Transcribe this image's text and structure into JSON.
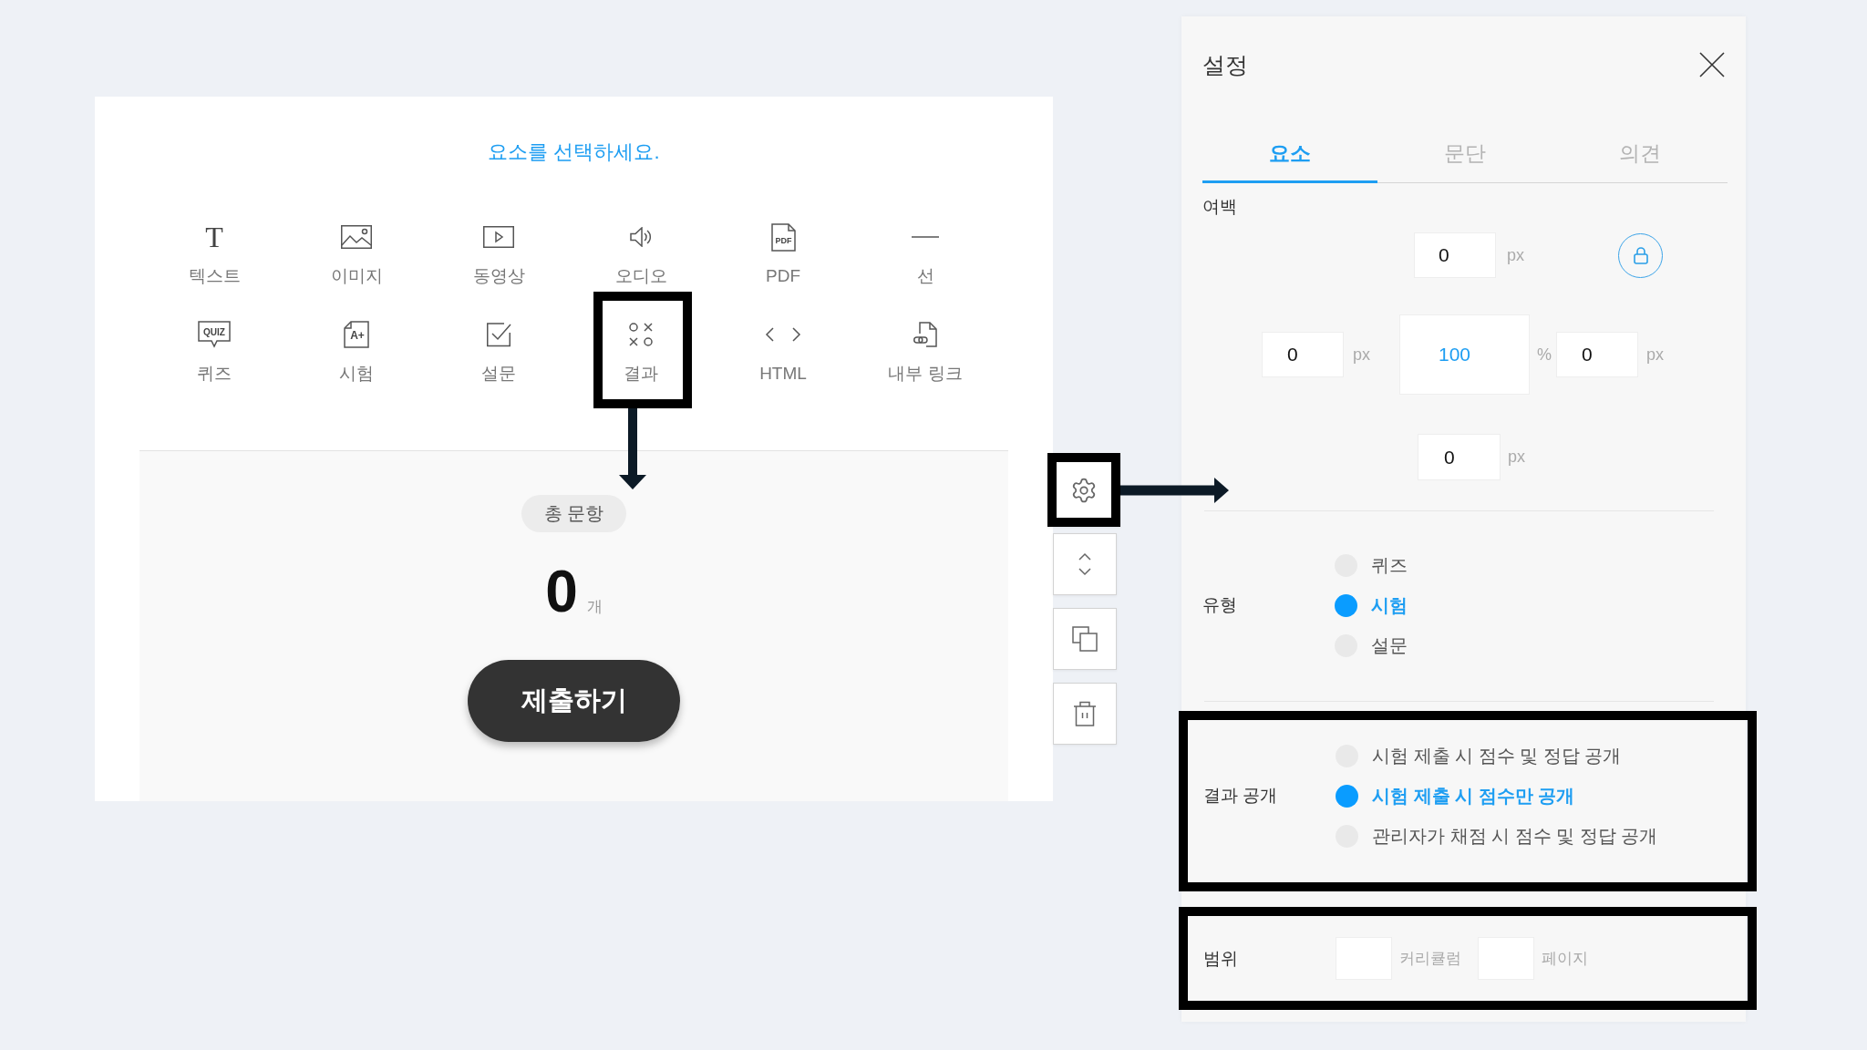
{
  "editor": {
    "prompt": "요소를 선택하세요.",
    "elements": [
      {
        "label": "텍스트",
        "kind": "letter",
        "icon_text": "T",
        "highlighted": false
      },
      {
        "label": "이미지",
        "kind": "image",
        "highlighted": false
      },
      {
        "label": "동영상",
        "kind": "video",
        "highlighted": false
      },
      {
        "label": "오디오",
        "kind": "audio",
        "highlighted": false
      },
      {
        "label": "PDF",
        "kind": "file",
        "icon_text": "PDF",
        "highlighted": false
      },
      {
        "label": "선",
        "kind": "line",
        "highlighted": false
      },
      {
        "label": "퀴즈",
        "kind": "bubble",
        "icon_text": "QUIZ",
        "highlighted": false
      },
      {
        "label": "시험",
        "kind": "grade",
        "icon_text": "A+",
        "highlighted": false
      },
      {
        "label": "설문",
        "kind": "checkbox",
        "highlighted": false
      },
      {
        "label": "결과",
        "kind": "ox",
        "highlighted": true
      },
      {
        "label": "HTML",
        "kind": "code",
        "highlighted": false
      },
      {
        "label": "내부 링크",
        "kind": "link",
        "highlighted": false
      }
    ],
    "summary": {
      "badge": "총 문항",
      "count": "0",
      "unit": "개"
    },
    "submit_button": "제출하기"
  },
  "toolbar": [
    {
      "kind": "settings",
      "highlighted": true
    },
    {
      "kind": "move",
      "highlighted": false
    },
    {
      "kind": "copy",
      "highlighted": false
    },
    {
      "kind": "delete",
      "highlighted": false
    }
  ],
  "settings_panel": {
    "title": "설정",
    "tabs": [
      {
        "label": "요소",
        "selected": true
      },
      {
        "label": "문단",
        "selected": false
      },
      {
        "label": "의견",
        "selected": false
      }
    ],
    "margin": {
      "label": "여백",
      "top": {
        "value": "0",
        "unit": "px"
      },
      "left": {
        "value": "0",
        "unit": "px"
      },
      "width": {
        "value": "100",
        "unit": "%"
      },
      "right": {
        "value": "0",
        "unit": "px"
      },
      "bottom": {
        "value": "0",
        "unit": "px"
      }
    },
    "type": {
      "label": "유형",
      "options": [
        {
          "label": "퀴즈",
          "selected": false
        },
        {
          "label": "시험",
          "selected": true
        },
        {
          "label": "설문",
          "selected": false
        }
      ]
    },
    "result_visibility": {
      "label": "결과 공개",
      "highlighted": true,
      "options": [
        {
          "label": "시험 제출 시 점수 및 정답 공개",
          "selected": false
        },
        {
          "label": "시험 제출 시 점수만 공개",
          "selected": true
        },
        {
          "label": "관리자가 채점 시 점수 및 정답 공개",
          "selected": false
        }
      ]
    },
    "range": {
      "label": "범위",
      "highlighted": true,
      "fields": [
        {
          "unit": "커리큘럼"
        },
        {
          "unit": "페이지"
        }
      ]
    }
  }
}
